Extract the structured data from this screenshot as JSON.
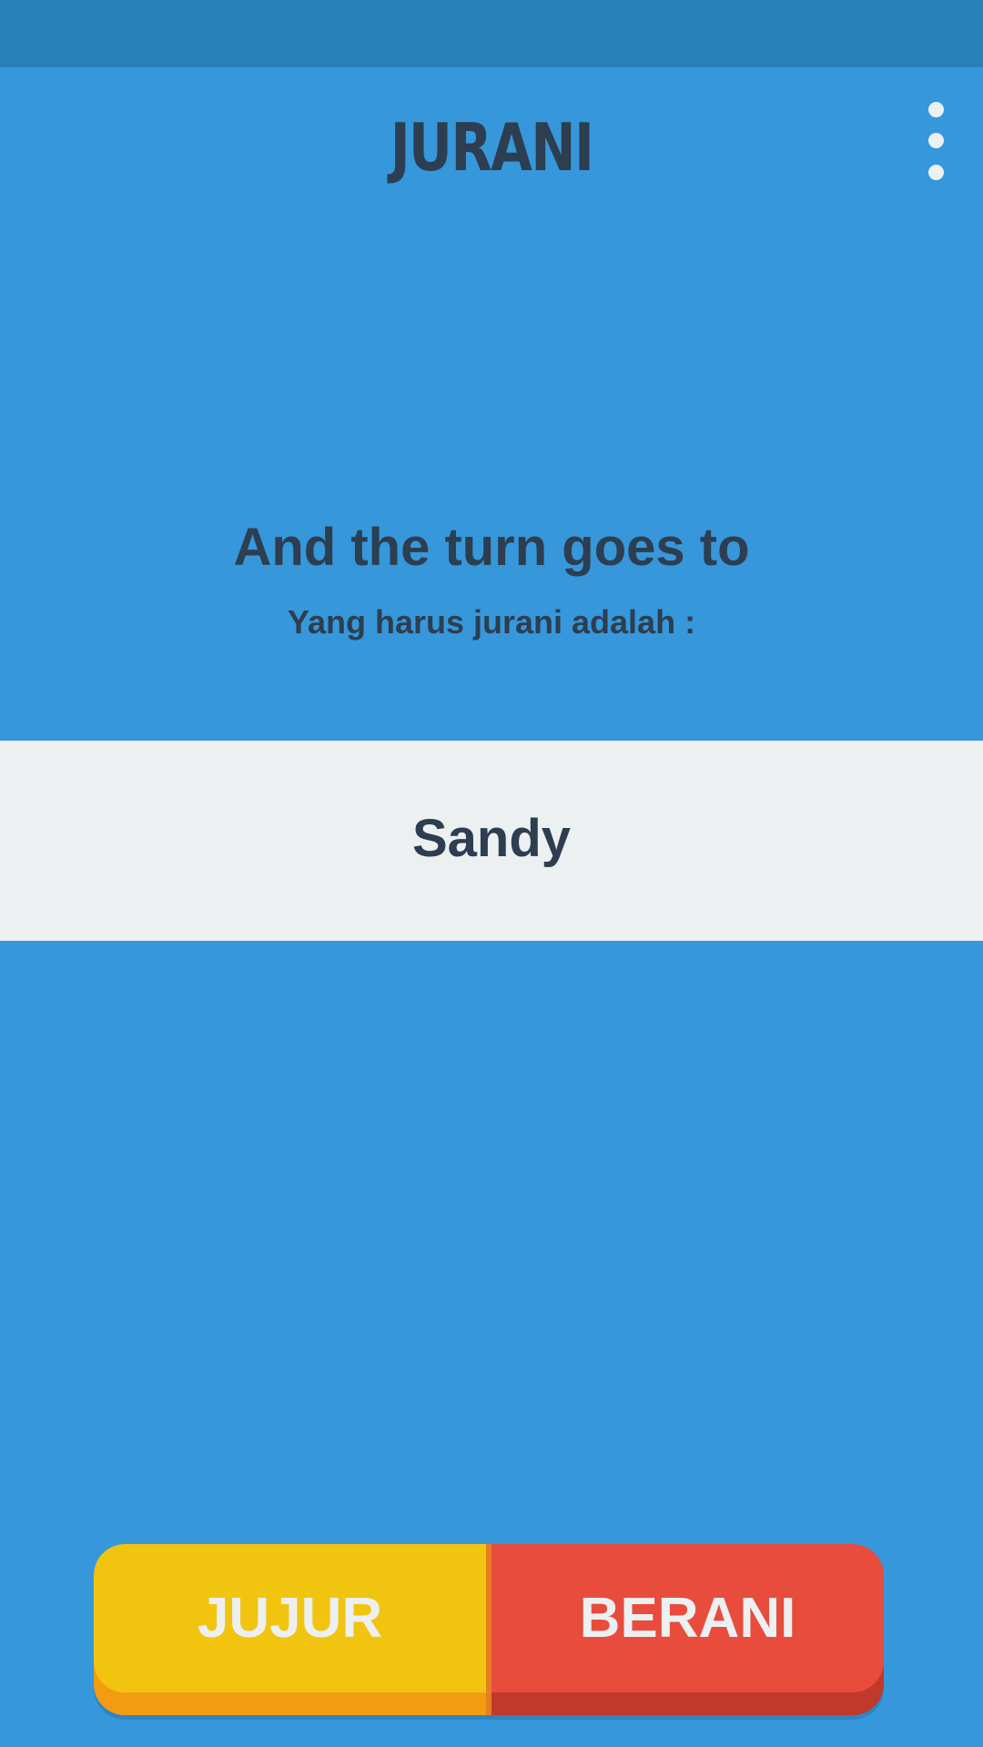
{
  "app": {
    "title": "JURANI"
  },
  "header": {
    "menu_icon": "more-vertical-icon"
  },
  "main": {
    "headline": "And the turn goes to",
    "subheadline": "Yang harus jurani adalah :",
    "player_name": "Sandy"
  },
  "actions": {
    "truth_label": "JUJUR",
    "dare_label": "BERANI"
  },
  "colors": {
    "background": "#3797DB",
    "status_bar": "#2A80BA",
    "text_dark": "#2C3E50",
    "band": "#ECF0F1",
    "truth": "#F1C40F",
    "truth_shade": "#F39C12",
    "dare": "#E74C3C",
    "dare_shade": "#C0392B"
  }
}
